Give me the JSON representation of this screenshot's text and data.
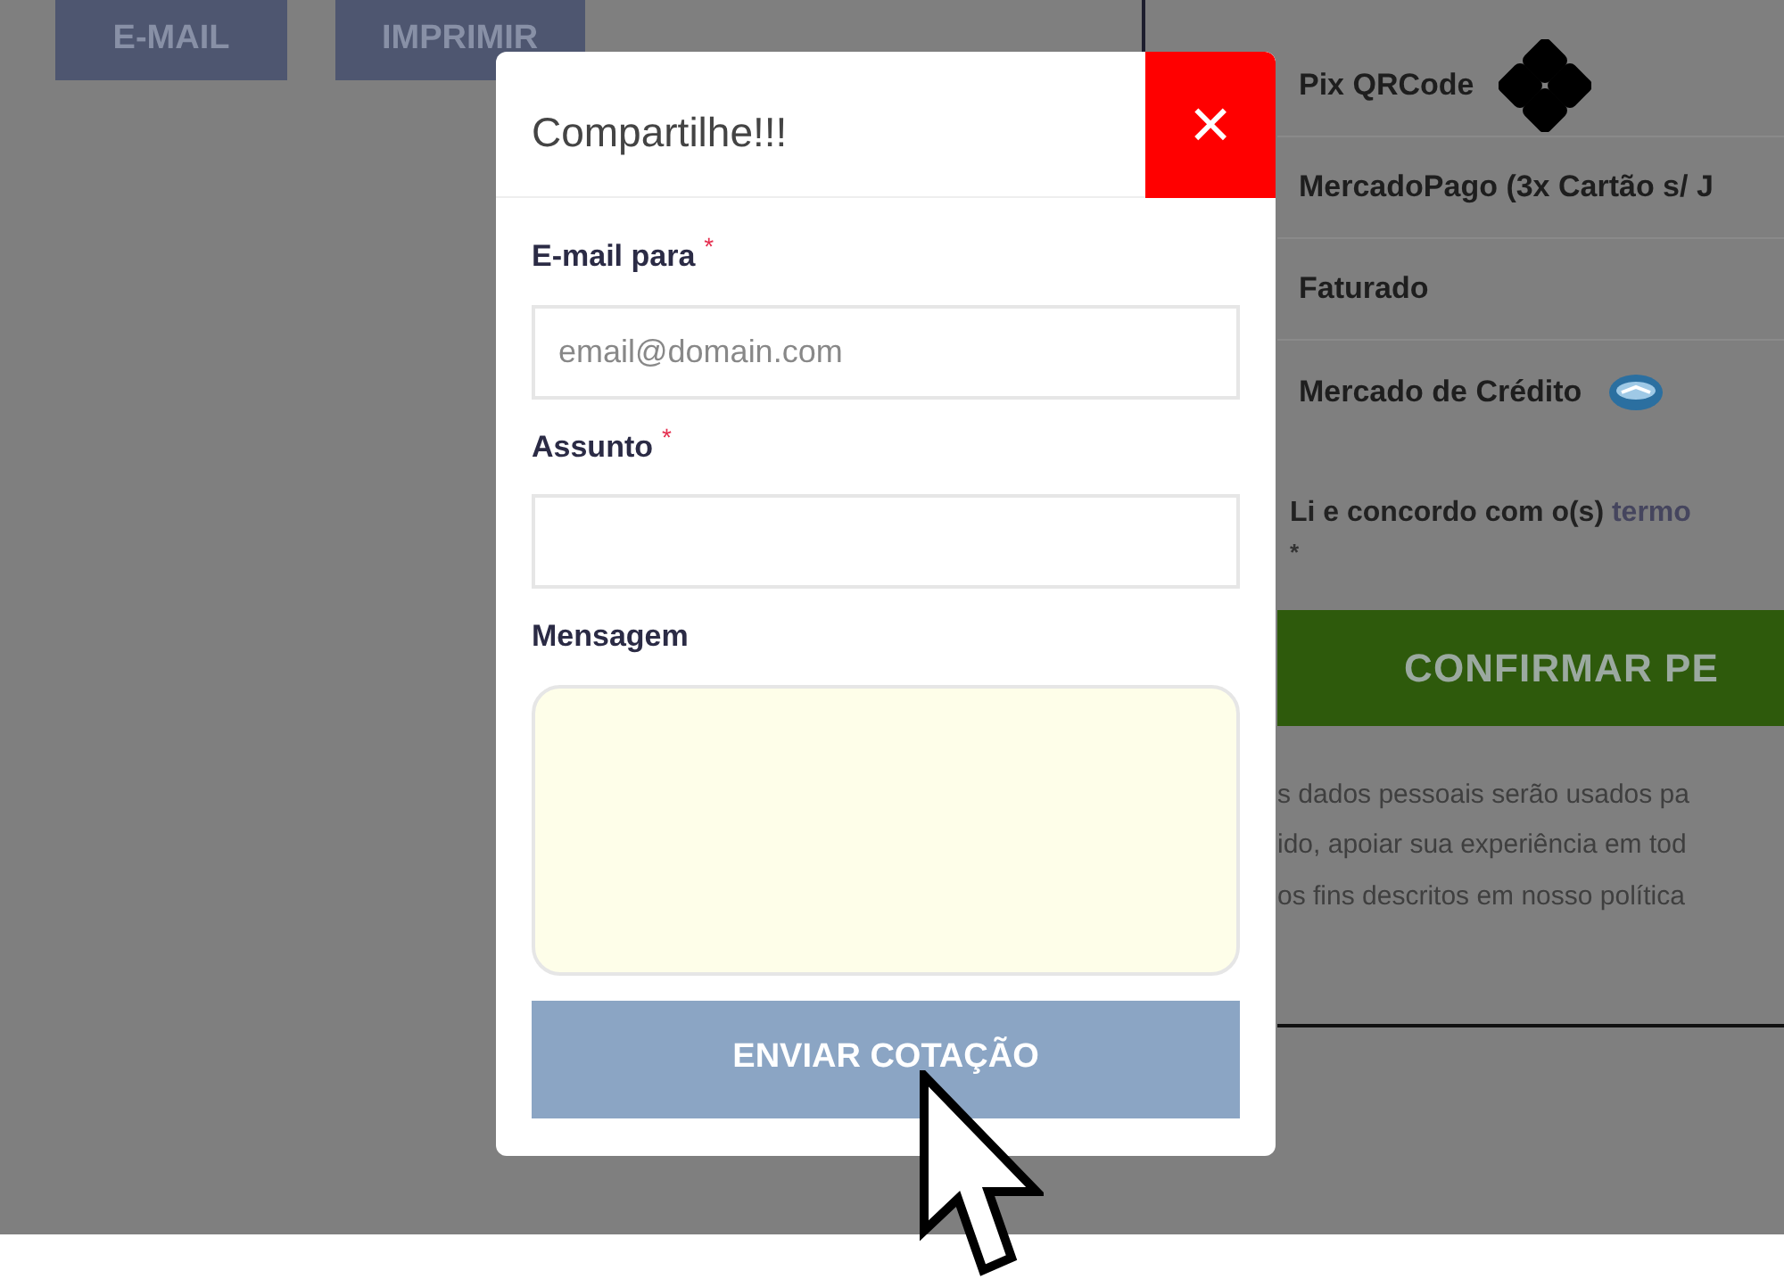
{
  "toolbar_buttons": [
    "E-MAIL",
    "IMPRIMIR"
  ],
  "payment_methods": [
    {
      "label": "Pix QRCode",
      "kind": "pix"
    },
    {
      "label": "MercadoPago (3x Cartão s/ J",
      "kind": "plain"
    },
    {
      "label": "Faturado",
      "kind": "plain"
    },
    {
      "label": "Mercado de Crédito",
      "kind": "credit"
    }
  ],
  "terms": {
    "text": "Li e concordo com o(s) ",
    "link": "termo",
    "required_mark": "*"
  },
  "confirm_button": "CONFIRMAR PE",
  "privacy_lines": [
    "s dados pessoais serão usados pa",
    "ido, apoiar sua experiência em tod",
    "os fins descritos em nosso política"
  ],
  "modal": {
    "title": "Compartilhe!!!",
    "close": "×",
    "fields": [
      {
        "label": "E-mail para",
        "required": true,
        "kind": "input",
        "placeholder": "email@domain.com"
      },
      {
        "label": "Assunto",
        "required": true,
        "kind": "input"
      },
      {
        "label": "Mensagem",
        "required": false,
        "kind": "textarea"
      }
    ],
    "required_mark": "*",
    "submit": "ENVIAR COTAÇÃO"
  }
}
